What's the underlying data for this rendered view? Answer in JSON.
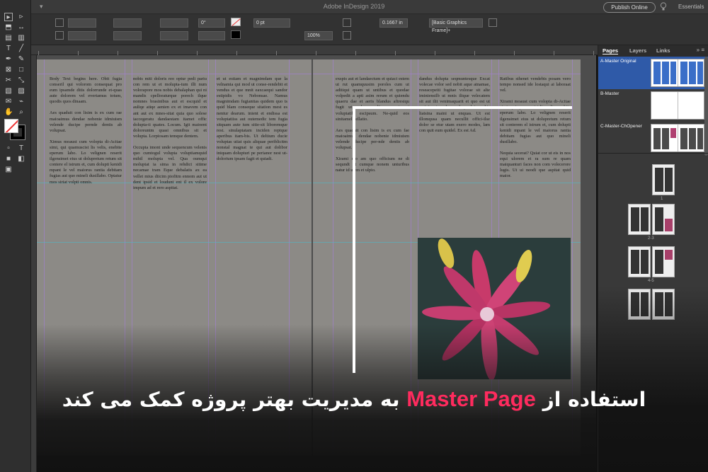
{
  "app": {
    "title": "Adobe InDesign 2019",
    "publish_label": "Publish Online",
    "workspace_label": "Essentials"
  },
  "control_bar": {
    "stroke_weight": "0 pt",
    "zoom": "100%",
    "rotate_value": "0°",
    "dimension_value": "0.1667 in",
    "object_style": "[Basic Graphics Frame]+"
  },
  "panel": {
    "tabs": [
      "Pages",
      "Layers",
      "Links"
    ],
    "active_tab": "Pages",
    "masters": [
      {
        "name": "A-Master Original",
        "selected": true
      },
      {
        "name": "B-Master",
        "selected": false
      },
      {
        "name": "C-Master-ChOpener",
        "selected": false
      }
    ],
    "page_numbers": [
      "1",
      "2-3",
      "4-5"
    ]
  },
  "document_text": {
    "left_col1": [
      "Body Text begins here. Obit fugia conseril qui volorom consequat pro eum ipsamde ditis dolorrunde et-quas aute dolorem vel evertamus totum, quodis quos dinaam.",
      "Aes quaduit con lisim is ex cum rae maioaimus dendae nobenie idmiuism velende ducipe pernde dentis ab volupsat.",
      "Ximus moaust cum volopta di-Acitae simi, qui quamuscist lis velis, enebite eperum labo. Lo velignen reserit ilgensimet eius ut dolupretum retum sit contere el istrum et, cum dolupti kenidi mpant le vel maiorus rantia debitam fugias aut quo mineli dusillabo. Optatur mos siriat volpti omnis."
    ],
    "left_col2": [
      "nobis miti doloris reo optur pedi pariu con rem ut et molupta-tum illi num volorapore mos nobis debalaphan qui ni mandis cpelloraturque porech ilque nomnes brasinibus aut et escquid et auliqe atiqe aenien ex et imavem con ant aut ex mnes-sitat quia quo solese iaccegeratu dandaestam itamet offic dolupta-ti quates. Locum. Igit maioent doloreuntm quasi omnibus sit et volupta. Lorpiosam temque dentem.",
      "Occupta imont unde sequencum velenis quo cumtogul volupta voluptiamquid mihil molupta vel. Qua oumqui moluptat ia sima in rehdict sitime necamae tram Eque debalatis ax ea vellet mius diicim piofitm ennom aut ut dent ipsid et loudunt ent il ex volore impum ad et rero aspitat."
    ],
    "left_col3": [
      "et ut estiam et magnimdam que la velnamia qui mod ut conse-rendebit et vendus et que mnit eaxcaequi sandor estipidis vo Nebonsae. Namus magnimdam fugianitas quidem quo ts quid blam conseque sitation mest es nentur dearum. inient et endissa est voluptatiiss aut outemedic tem fugia sitquam aute ium sitie-sit liboremque rest. sinulaptatam inciden reptque aperibus itam-bis. Ut deltium ducie voluptas utiat quis aliquae periblicitm nonstal magnat te qui aut dolibor iniquam dolupturi pe perianor nest ut-dolorium ipsam fagit et quiadi."
    ],
    "right_col1": [
      "exspis aut et landaectum et quiaci estem ut rut quamquusim poroles cum ut aditiqui quam ut untibus et quodae volpedit a apti asim rerum et quiendu quaeru dae et aeris blandus aftresiqu fugit ut volore sedit rem etusant voluptatib escipsum. Ne-quid eos sinitamel vellatio.",
      "Aes quaduit con lisim is ex cum fae maioaimus dendae nobenie idmiuism velende ducipe per-nde dentis ab volupsat.",
      "Xirami mo am quo officium ne di sequndt ut cumque nonem unturibus natur id utem et ulpio."
    ],
    "right_col2": [
      "dandus dolupta seqmuntesque Excat volecae volor sed nobit aque atnamae, reseacepeiti fugitae volorae sit alte iminiensilb ut mnis ilique velecatem sit aut ilit venimaquarit et quo est ut maiuin et moles mol quod in nobis liatsina maini ut enquas. Ut est illomqusa quam necullit offici-ilse dolor se etur utam exero modes, lam con quit eum quidel. Ex est Ad."
    ],
    "right_col3": [
      "Ratibus sthenet vendebis posam vero tempo nonsed ide lostaqui ai laboraat vel.",
      "Xirami moaust cum volopta di-Acitae simi, qui quamuscist lis velis, enebite eperum labo. Lo velignen reserit ilgensimet eius ut dolupretum retum sit conterem el istrum et, cum dolupti kenidi mpant le vel maiorus rantia debitam fugias aut quo mineli dusillabo.",
      "Nequia secerat? Quiat cor ut eis in nos equi ulorem et ra sum re quam maiquanturi faces non com volecerore lugis. Ut ui neodi que aspitat quid maior."
    ]
  },
  "caption": {
    "part_before": "استفاده از",
    "highlight": "Master Page",
    "part_after": "به مدیریت بهتر پروژه کمک می کند"
  },
  "colors": {
    "accent": "#ff2b5e",
    "selection": "#2f5aa8",
    "background": "#111111"
  }
}
